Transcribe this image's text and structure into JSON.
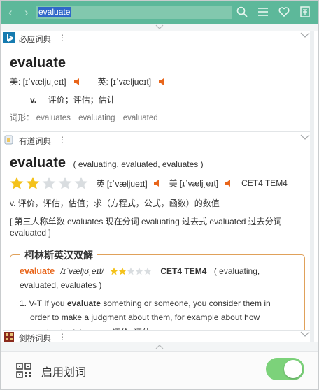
{
  "search": {
    "query": "evaluate"
  },
  "toolbar": {
    "back_glyph": "‹",
    "forward_glyph": "›",
    "icons": [
      "search-icon",
      "menu-icon",
      "heart-icon",
      "book-icon"
    ]
  },
  "bing": {
    "name": "必应词典",
    "more": "⋮",
    "headword": "evaluate",
    "us_label": "美: [ɪˈvæljuˌeɪt]",
    "uk_label": "英: [ɪˈvæljueɪt]",
    "pos": "v.",
    "definition": "评价；评估；估计",
    "forms_label": "词形：",
    "forms": [
      "evaluates",
      "evaluating",
      "evaluated"
    ]
  },
  "youdao": {
    "name": "有道词典",
    "more": "⋮",
    "headword": "evaluate",
    "inflections": "( evaluating, evaluated, evaluates )",
    "stars": 2,
    "stars_total": 5,
    "uk_phon": "英 [ɪˈvæljueɪt]",
    "us_phon": "美 [ɪˈvæljˌeɪt]",
    "levels": "CET4 TEM4",
    "definition": "v. 评价，评估，估值；求（方程式，公式，函数）的数值",
    "forms_note_1": "[ 第三人称单数 evaluates 现在分词 evaluating 过去式 evaluated 过去分词",
    "forms_note_2": "evaluated ]"
  },
  "collins": {
    "title": "柯林斯英汉双解",
    "headword": "evaluate",
    "phon": "/ɪˈvæljʊˌeɪt/",
    "stars": 2,
    "stars_total": 5,
    "levels": "CET4 TEM4",
    "inflections_1": "( evaluating,",
    "inflections_2": "evaluated, evaluates )",
    "sense_num": "1.",
    "sense_tag": "V-T",
    "sense_pre": "If you",
    "sense_kw": "evaluate",
    "sense_post": "something or someone, you consider them in",
    "sense_line2": "order to make a judgment about them, for example about how",
    "sense_line3": "good or bad they are. 评价; 评估"
  },
  "cambridge": {
    "name": "剑桥词典",
    "more": "⋮"
  },
  "footer": {
    "label": "启用划词",
    "toggle_on": true
  },
  "colors": {
    "accent": "#5db89a",
    "speaker": "#e8651a",
    "star_on": "#f4c21b",
    "star_off": "#d9dde0",
    "toggle": "#7cd27a"
  }
}
